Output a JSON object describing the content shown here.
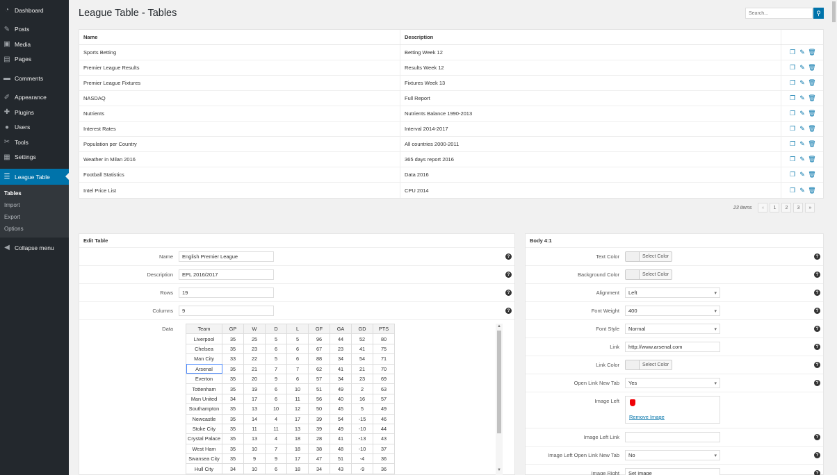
{
  "sidebar": {
    "items": [
      {
        "label": "Dashboard",
        "icon": "dashboard-icon"
      },
      {
        "label": "Posts",
        "icon": "pin-icon"
      },
      {
        "label": "Media",
        "icon": "media-icon"
      },
      {
        "label": "Pages",
        "icon": "pages-icon"
      },
      {
        "label": "Comments",
        "icon": "comments-icon"
      },
      {
        "label": "Appearance",
        "icon": "brush-icon"
      },
      {
        "label": "Plugins",
        "icon": "plugin-icon"
      },
      {
        "label": "Users",
        "icon": "users-icon"
      },
      {
        "label": "Tools",
        "icon": "tools-icon"
      },
      {
        "label": "Settings",
        "icon": "settings-icon"
      },
      {
        "label": "League Table",
        "icon": "table-icon"
      }
    ],
    "submenu": [
      "Tables",
      "Import",
      "Export",
      "Options"
    ],
    "collapse": "Collapse menu"
  },
  "page": {
    "title": "League Table - Tables",
    "search_placeholder": "Search..."
  },
  "list": {
    "headers": [
      "Name",
      "Description"
    ],
    "rows": [
      [
        "Sports Betting",
        "Betting Week 12"
      ],
      [
        "Premier League Results",
        "Results Week 12"
      ],
      [
        "Premier League Fixtures",
        "Fixtures Week 13"
      ],
      [
        "NASDAQ",
        "Full Report"
      ],
      [
        "Nutrients",
        "Nutrients Balance 1990-2013"
      ],
      [
        "Interest Rates",
        "Interval 2014-2017"
      ],
      [
        "Population per Country",
        "All countries 2000-2011"
      ],
      [
        "Weather in Milan 2016",
        "365 days report 2016"
      ],
      [
        "Football Statistics",
        "Data 2016"
      ],
      [
        "Intel Price List",
        "CPU 2014"
      ]
    ]
  },
  "pager": {
    "count": "23 items",
    "first": "«",
    "prev": "‹",
    "pages": [
      "1",
      "2",
      "3"
    ],
    "last": "»"
  },
  "edit": {
    "title": "Edit Table",
    "fields": [
      {
        "label": "Name",
        "value": "English Premier League"
      },
      {
        "label": "Description",
        "value": "EPL 2016/2017"
      },
      {
        "label": "Rows",
        "value": "19"
      },
      {
        "label": "Columns",
        "value": "9"
      }
    ],
    "data_label": "Data",
    "grid_headers": [
      "Team",
      "GP",
      "W",
      "D",
      "L",
      "GF",
      "GA",
      "GD",
      "PTS"
    ],
    "grid_rows": [
      [
        "Liverpool",
        "35",
        "25",
        "5",
        "5",
        "96",
        "44",
        "52",
        "80"
      ],
      [
        "Chelsea",
        "35",
        "23",
        "6",
        "6",
        "67",
        "23",
        "41",
        "75"
      ],
      [
        "Man City",
        "33",
        "22",
        "5",
        "6",
        "88",
        "34",
        "54",
        "71"
      ],
      [
        "Arsenal",
        "35",
        "21",
        "7",
        "7",
        "62",
        "41",
        "21",
        "70"
      ],
      [
        "Everton",
        "35",
        "20",
        "9",
        "6",
        "57",
        "34",
        "23",
        "69"
      ],
      [
        "Tottenham",
        "35",
        "19",
        "6",
        "10",
        "51",
        "49",
        "2",
        "63"
      ],
      [
        "Man United",
        "34",
        "17",
        "6",
        "11",
        "56",
        "40",
        "16",
        "57"
      ],
      [
        "Southampton",
        "35",
        "13",
        "10",
        "12",
        "50",
        "45",
        "5",
        "49"
      ],
      [
        "Newcastle",
        "35",
        "14",
        "4",
        "17",
        "39",
        "54",
        "-15",
        "46"
      ],
      [
        "Stoke City",
        "35",
        "11",
        "11",
        "13",
        "39",
        "49",
        "-10",
        "44"
      ],
      [
        "Crystal Palace",
        "35",
        "13",
        "4",
        "18",
        "28",
        "41",
        "-13",
        "43"
      ],
      [
        "West Ham",
        "35",
        "10",
        "7",
        "18",
        "38",
        "48",
        "-10",
        "37"
      ],
      [
        "Swansea City",
        "35",
        "9",
        "9",
        "17",
        "47",
        "51",
        "-4",
        "36"
      ],
      [
        "Hull City",
        "34",
        "10",
        "6",
        "18",
        "34",
        "43",
        "-9",
        "36"
      ]
    ]
  },
  "body": {
    "title": "Body 4:1",
    "fields": [
      {
        "label": "Text Color",
        "type": "color",
        "value": "Select Color"
      },
      {
        "label": "Background Color",
        "type": "color",
        "value": "Select Color"
      },
      {
        "label": "Alignment",
        "type": "select",
        "value": "Left"
      },
      {
        "label": "Font Weight",
        "type": "select",
        "value": "400"
      },
      {
        "label": "Font Style",
        "type": "select",
        "value": "Normal"
      },
      {
        "label": "Link",
        "type": "text",
        "value": "http://www.arsenal.com"
      },
      {
        "label": "Link Color",
        "type": "color",
        "value": "Select Color"
      },
      {
        "label": "Open Link New Tab",
        "type": "select",
        "value": "Yes"
      },
      {
        "label": "Image Left",
        "type": "image",
        "value": "Remove Image"
      },
      {
        "label": "Image Left Link",
        "type": "text",
        "value": ""
      },
      {
        "label": "Image Left Open Link New Tab",
        "type": "select",
        "value": "No"
      },
      {
        "label": "Image Right",
        "type": "text",
        "value": "Set image"
      }
    ]
  },
  "help_glyph": "?",
  "colors": {
    "accent": "#0073aa",
    "sidebar": "#23282d",
    "submenu": "#32373c"
  }
}
